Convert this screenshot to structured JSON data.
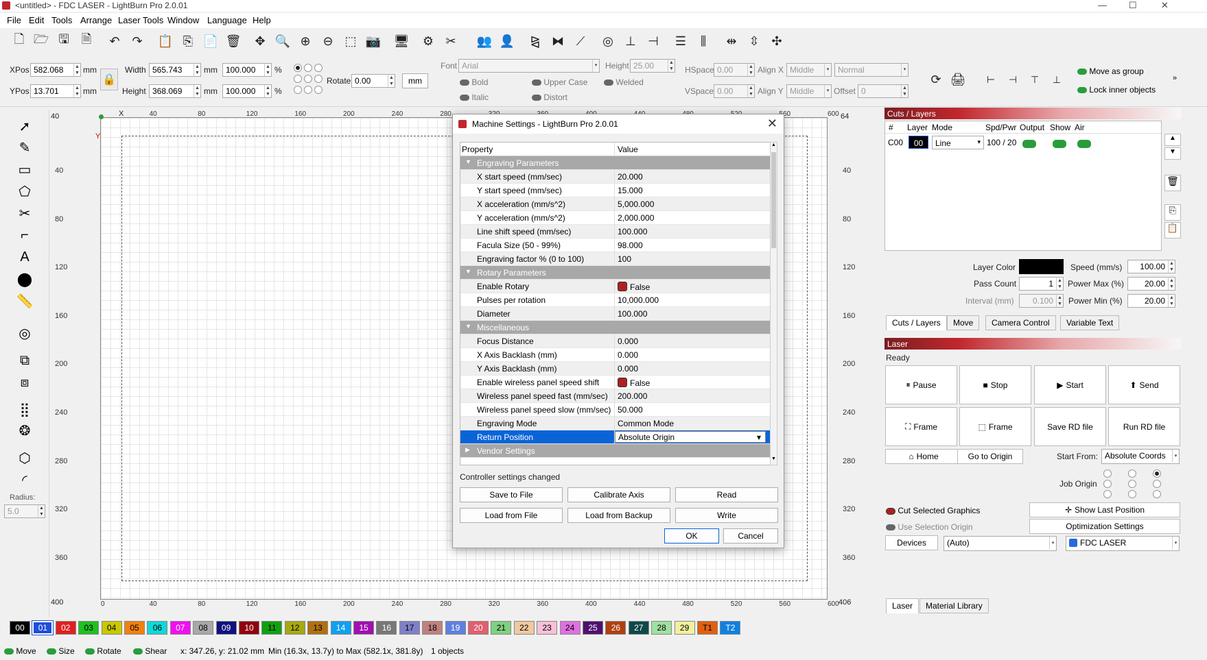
{
  "window": {
    "title": "<untitled> - FDC LASER - LightBurn Pro 2.0.01",
    "min": "—",
    "max": "☐",
    "close": "✕"
  },
  "menu": [
    "File",
    "Edit",
    "Tools",
    "Arrange",
    "Laser Tools",
    "Window",
    "Language",
    "Help"
  ],
  "props": {
    "xpos_label": "XPos",
    "xpos": "582.068",
    "ypos_label": "YPos",
    "ypos": "13.701",
    "unit": "mm",
    "width_label": "Width",
    "width": "565.743",
    "height_label": "Height",
    "height": "368.069",
    "pct_w": "100.000",
    "pct_h": "100.000",
    "pct": "%",
    "rotate_label": "Rotate",
    "rotate": "0.00",
    "mm_btn": "mm",
    "font_label": "Font",
    "font": "Arial",
    "fheight_label": "Height",
    "fheight": "25.00",
    "hspace_label": "HSpace",
    "hspace": "0.00",
    "vspace_label": "VSpace",
    "vspace": "0.00",
    "alignx_label": "Align X",
    "alignx": "Middle",
    "aligny_label": "Align Y",
    "aligny": "Middle",
    "normal": "Normal",
    "offset_label": "Offset",
    "offset": "0",
    "bold": "Bold",
    "italic": "Italic",
    "upper": "Upper Case",
    "distort": "Distort",
    "welded": "Welded",
    "move_group": "Move as group",
    "lock_inner": "Lock inner objects"
  },
  "left_tools": {
    "radius_label": "Radius:",
    "radius": "5.0"
  },
  "rulers": {
    "top": [
      "0",
      "40",
      "80",
      "120",
      "160",
      "200",
      "240",
      "280",
      "320",
      "360",
      "400",
      "440",
      "480",
      "520",
      "560",
      "600"
    ],
    "left": [
      "40",
      "80",
      "120",
      "160",
      "200",
      "240",
      "280",
      "320",
      "360"
    ],
    "corner_top": "40",
    "corner_bottom": "400",
    "x": "X",
    "y": "Y",
    "right_top": "64",
    "right_bottom": "406"
  },
  "dialog": {
    "title": "Machine Settings - LightBurn Pro 2.0.01",
    "col_property": "Property",
    "col_value": "Value",
    "rows": [
      {
        "t": "cat",
        "n": "Engraving Parameters"
      },
      {
        "n": "X start speed (mm/sec)",
        "v": "20.000"
      },
      {
        "n": "Y start speed (mm/sec)",
        "v": "15.000"
      },
      {
        "n": "X acceleration (mm/s^2)",
        "v": "5,000.000"
      },
      {
        "n": "Y acceleration (mm/s^2)",
        "v": "2,000.000"
      },
      {
        "n": "Line shift speed (mm/sec)",
        "v": "100.000"
      },
      {
        "n": "Facula Size (50 - 99%)",
        "v": "98.000"
      },
      {
        "n": "Engraving factor % (0 to 100)",
        "v": "100"
      },
      {
        "t": "cat",
        "n": "Rotary Parameters"
      },
      {
        "n": "Enable Rotary",
        "v": "False",
        "tog": true
      },
      {
        "n": "Pulses per rotation",
        "v": "10,000.000"
      },
      {
        "n": "Diameter",
        "v": "100.000"
      },
      {
        "t": "cat",
        "n": "Miscellaneous"
      },
      {
        "n": "Focus Distance",
        "v": "0.000"
      },
      {
        "n": "X Axis Backlash (mm)",
        "v": "0.000"
      },
      {
        "n": "Y Axis Backlash (mm)",
        "v": "0.000"
      },
      {
        "n": "Enable wireless panel speed shift",
        "v": "False",
        "tog": true
      },
      {
        "n": "Wireless panel speed fast (mm/sec)",
        "v": "200.000"
      },
      {
        "n": "Wireless panel speed slow (mm/sec)",
        "v": "50.000"
      },
      {
        "n": "Engraving Mode",
        "v": "Common Mode"
      },
      {
        "t": "sel",
        "n": "Return Position",
        "v": "Absolute Origin"
      },
      {
        "t": "catc",
        "n": "Vendor Settings"
      }
    ],
    "status": "Controller settings changed",
    "save_file": "Save to File",
    "calibrate": "Calibrate Axis",
    "read": "Read",
    "load_file": "Load from File",
    "load_backup": "Load from Backup",
    "write": "Write",
    "ok": "OK",
    "cancel": "Cancel"
  },
  "cuts": {
    "header": "Cuts / Layers",
    "cols": [
      "#",
      "Layer",
      "Mode",
      "Spd/Pwr",
      "Output",
      "Show",
      "Air"
    ],
    "row": {
      "num": "C00",
      "layer": "00",
      "mode": "Line",
      "spd": "100 / 20"
    },
    "layer_color": "Layer Color",
    "speed_label": "Speed (mm/s)",
    "speed": "100.00",
    "pass_label": "Pass Count",
    "pass": "1",
    "pmax_label": "Power Max (%)",
    "pmax": "20.00",
    "interval_label": "Interval (mm)",
    "interval": "0.100",
    "pmin_label": "Power Min (%)",
    "pmin": "20.00",
    "tabs": [
      "Cuts / Layers",
      "Move",
      "Camera Control",
      "Variable Text"
    ]
  },
  "laser": {
    "header": "Laser",
    "state": "Ready",
    "pause": "Pause",
    "stop": "Stop",
    "start": "Start",
    "send": "Send",
    "frame1": "Frame",
    "frame2": "Frame",
    "save_rd": "Save RD file",
    "run_rd": "Run RD file",
    "home": "Home",
    "goto_origin": "Go to Origin",
    "start_from_label": "Start From:",
    "start_from": "Absolute Coords",
    "job_origin": "Job Origin",
    "cut_selected": "Cut Selected Graphics",
    "use_sel_origin": "Use Selection Origin",
    "show_last": "Show Last Position",
    "opt_settings": "Optimization Settings",
    "devices": "Devices",
    "auto": "(Auto)",
    "device": "FDC LASER",
    "tabs": [
      "Laser",
      "Material Library"
    ]
  },
  "palette": [
    {
      "l": "00",
      "c": "#000000",
      "f": "#fff"
    },
    {
      "l": "01",
      "c": "#1d4fd8",
      "f": "#fff"
    },
    {
      "l": "02",
      "c": "#e02020",
      "f": "#fff"
    },
    {
      "l": "03",
      "c": "#20c020",
      "f": "#000"
    },
    {
      "l": "04",
      "c": "#c8c800",
      "f": "#000"
    },
    {
      "l": "05",
      "c": "#f08010",
      "f": "#000"
    },
    {
      "l": "06",
      "c": "#10d8d8",
      "f": "#000"
    },
    {
      "l": "07",
      "c": "#f010f0",
      "f": "#fff"
    },
    {
      "l": "08",
      "c": "#a8a8a8",
      "f": "#000"
    },
    {
      "l": "09",
      "c": "#101080",
      "f": "#fff"
    },
    {
      "l": "10",
      "c": "#900010",
      "f": "#fff"
    },
    {
      "l": "11",
      "c": "#10a010",
      "f": "#000"
    },
    {
      "l": "12",
      "c": "#a8a810",
      "f": "#000"
    },
    {
      "l": "13",
      "c": "#b07010",
      "f": "#000"
    },
    {
      "l": "14",
      "c": "#10a0f0",
      "f": "#fff"
    },
    {
      "l": "15",
      "c": "#a010b0",
      "f": "#fff"
    },
    {
      "l": "16",
      "c": "#787878",
      "f": "#fff"
    },
    {
      "l": "17",
      "c": "#8080c8",
      "f": "#000"
    },
    {
      "l": "18",
      "c": "#c08080",
      "f": "#000"
    },
    {
      "l": "19",
      "c": "#6080e0",
      "f": "#fff"
    },
    {
      "l": "20",
      "c": "#e06070",
      "f": "#fff"
    },
    {
      "l": "21",
      "c": "#80d080",
      "f": "#000"
    },
    {
      "l": "22",
      "c": "#f0c8a0",
      "f": "#000"
    },
    {
      "l": "23",
      "c": "#f8c0d8",
      "f": "#000"
    },
    {
      "l": "24",
      "c": "#e070e0",
      "f": "#000"
    },
    {
      "l": "25",
      "c": "#501070",
      "f": "#fff"
    },
    {
      "l": "26",
      "c": "#b04010",
      "f": "#fff"
    },
    {
      "l": "27",
      "c": "#104848",
      "f": "#fff"
    },
    {
      "l": "28",
      "c": "#a0e0a0",
      "f": "#000"
    },
    {
      "l": "29",
      "c": "#f0f0a0",
      "f": "#000"
    },
    {
      "l": "T1",
      "c": "#e06010",
      "f": "#000"
    },
    {
      "l": "T2",
      "c": "#1080e0",
      "f": "#fff"
    }
  ],
  "status": {
    "move": "Move",
    "size": "Size",
    "rotate": "Rotate",
    "shear": "Shear",
    "coords": "x: 347.26, y: 21.02 mm",
    "range": "Min (16.3x, 13.7y) to Max (582.1x, 381.8y)",
    "objects": "1 objects"
  }
}
